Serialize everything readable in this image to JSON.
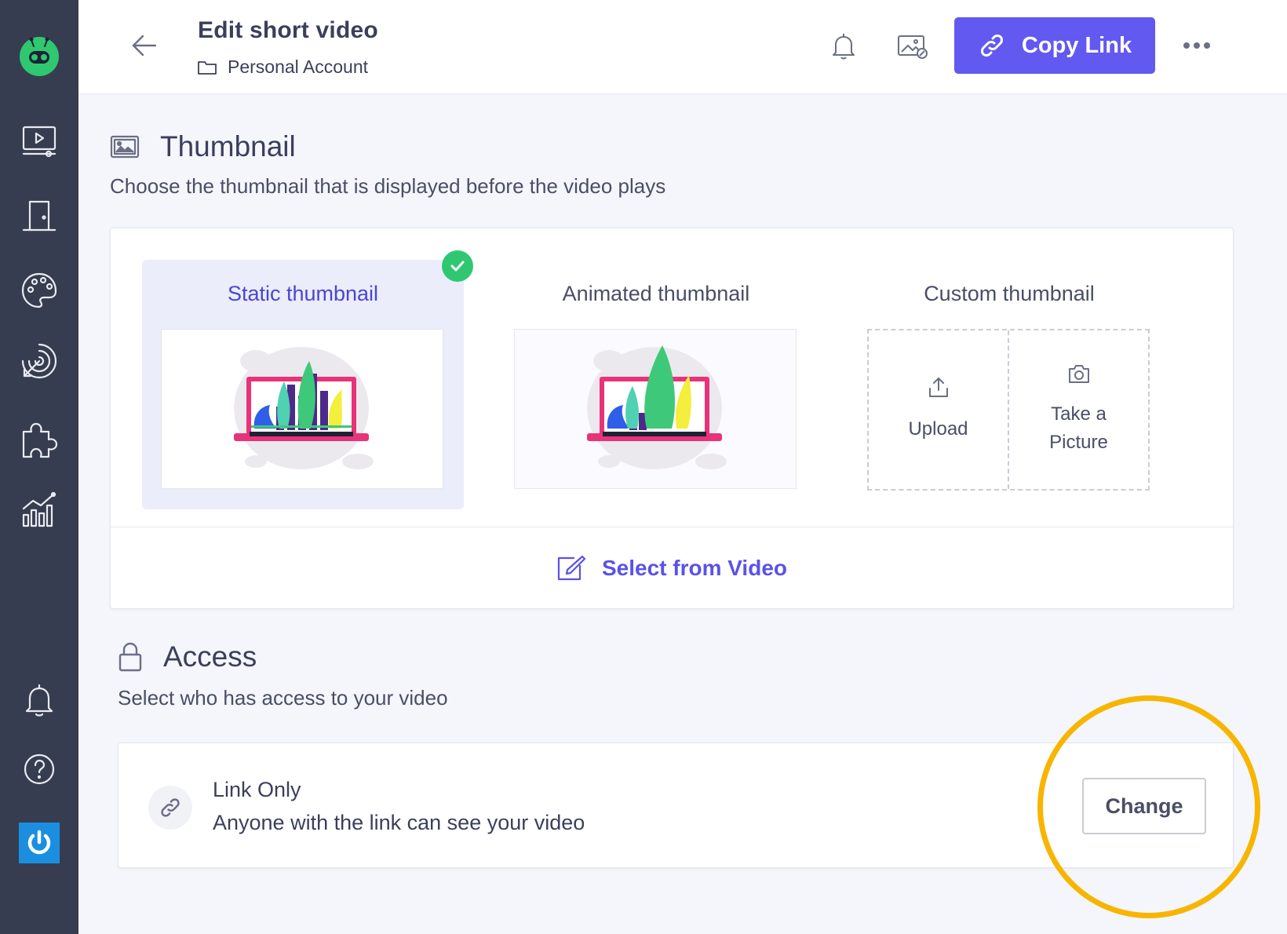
{
  "header": {
    "title": "Edit short video",
    "breadcrumb": "Personal Account",
    "copy_link_label": "Copy Link",
    "icons": [
      "back-arrow-icon",
      "bell-icon",
      "image-link-icon",
      "link-icon",
      "more-icon"
    ]
  },
  "sidebar": {
    "items": [
      "logo-icon",
      "video-library-icon",
      "door-icon",
      "palette-icon",
      "target-icon",
      "puzzle-icon",
      "analytics-icon",
      "bell-icon",
      "help-icon",
      "power-icon"
    ]
  },
  "thumbnail": {
    "title": "Thumbnail",
    "description": "Choose the thumbnail that is displayed before the video plays",
    "options": [
      {
        "label": "Static thumbnail",
        "selected": true
      },
      {
        "label": "Animated thumbnail",
        "selected": false
      },
      {
        "label": "Custom thumbnail",
        "selected": false
      }
    ],
    "custom_actions": {
      "upload": "Upload",
      "take_picture_line1": "Take a",
      "take_picture_line2": "Picture"
    },
    "select_from_video": "Select from Video"
  },
  "access": {
    "title": "Access",
    "description": "Select who has access to your video",
    "current_name": "Link Only",
    "current_description": "Anyone with the link can see your video",
    "change_label": "Change"
  },
  "colors": {
    "accent": "#6259f0",
    "selected_text": "#4a46d4",
    "success": "#2fc871",
    "sidebar": "#373d50",
    "highlight": "#f7b500"
  }
}
